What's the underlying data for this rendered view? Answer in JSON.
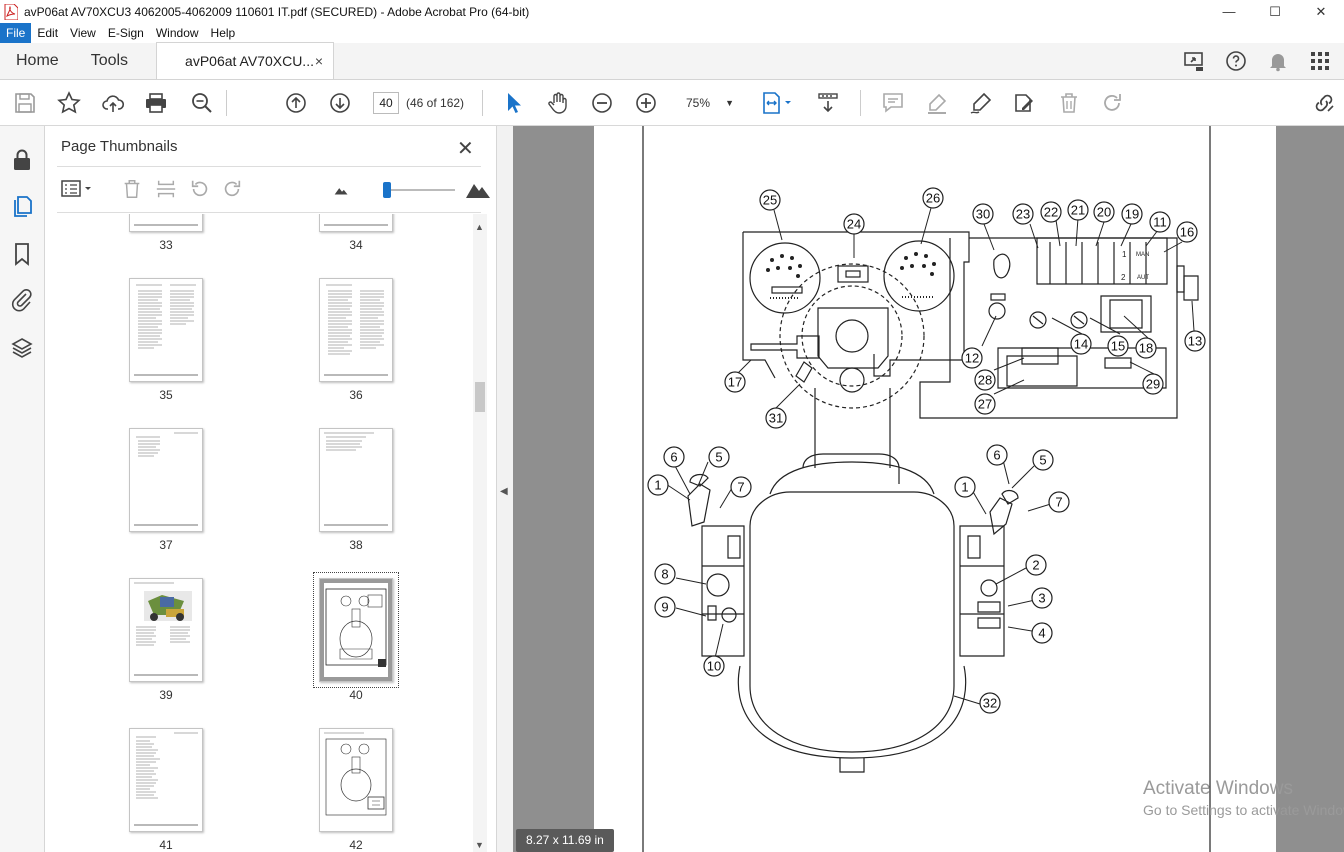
{
  "window": {
    "title": "avP06at AV70XCU3 4062005-4062009 110601 IT.pdf (SECURED) - Adobe Acrobat Pro (64-bit)",
    "minimize": "—",
    "maximize": "☐",
    "close": "✕"
  },
  "menu": [
    "File",
    "Edit",
    "View",
    "E-Sign",
    "Window",
    "Help"
  ],
  "tabs": {
    "home": "Home",
    "tools": "Tools",
    "document": "avP06at AV70XCU...",
    "close": "×"
  },
  "toolbar": {
    "page_number": "40",
    "page_count": "(46 of 162)",
    "zoom": "75%"
  },
  "panel": {
    "title": "Page Thumbnails",
    "close": "✕",
    "slider_value": 0.1,
    "thumbnails": [
      {
        "label": "33"
      },
      {
        "label": "34"
      },
      {
        "label": "35"
      },
      {
        "label": "36"
      },
      {
        "label": "37"
      },
      {
        "label": "38"
      },
      {
        "label": "39"
      },
      {
        "label": "40"
      },
      {
        "label": "41"
      },
      {
        "label": "42"
      }
    ],
    "selected": "40"
  },
  "document": {
    "page_size": "8.27 x 11.69 in",
    "callouts": [
      "25",
      "24",
      "26",
      "30",
      "23",
      "22",
      "21",
      "20",
      "19",
      "11",
      "16",
      "13",
      "12",
      "14",
      "15",
      "18",
      "28",
      "29",
      "27",
      "17",
      "31",
      "6",
      "5",
      "1",
      "7",
      "6",
      "5",
      "7",
      "1",
      "8",
      "9",
      "10",
      "2",
      "3",
      "4",
      "32"
    ],
    "panel_texts": {
      "man": "MAN",
      "aut": "AUT",
      "one": "1",
      "two": "2"
    }
  },
  "watermark": {
    "line1": "Activate Windows",
    "line2": "Go to Settings to activate Windows."
  },
  "colors": {
    "accent": "#1a73c9",
    "doc_background": "#8f8f8f",
    "pdf_red": "#d22"
  }
}
